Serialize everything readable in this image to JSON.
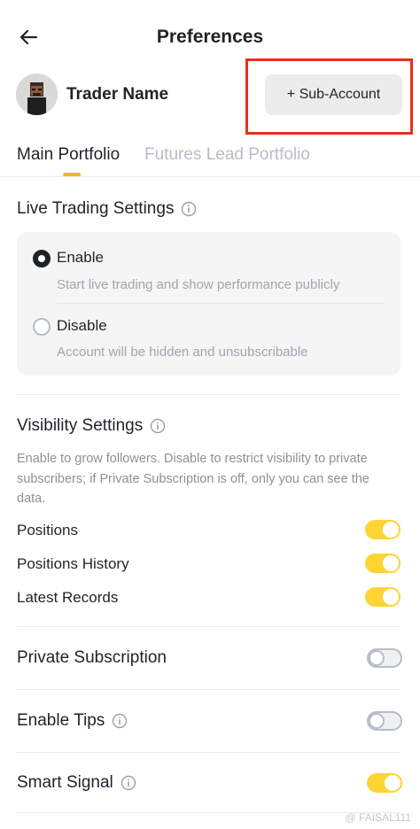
{
  "header": {
    "title": "Preferences"
  },
  "profile": {
    "name": "Trader Name",
    "sub_account_label": "+ Sub-Account"
  },
  "tabs": [
    {
      "label": "Main Portfolio",
      "active": true
    },
    {
      "label": "Futures Lead Portfolio",
      "active": false
    }
  ],
  "live_trading": {
    "title": "Live Trading Settings",
    "options": [
      {
        "label": "Enable",
        "description": "Start live trading and show performance publicly",
        "selected": true
      },
      {
        "label": "Disable",
        "description": "Account will be hidden and unsubscribable",
        "selected": false
      }
    ]
  },
  "visibility": {
    "title": "Visibility Settings",
    "description": "Enable to grow followers. Disable to restrict visibility to private subscribers; if Private Subscription is off, only you can see the data.",
    "items": [
      {
        "label": "Positions",
        "enabled": true
      },
      {
        "label": "Positions History",
        "enabled": true
      },
      {
        "label": "Latest Records",
        "enabled": true
      }
    ]
  },
  "settings": [
    {
      "label": "Private Subscription",
      "enabled": false
    },
    {
      "label": "Enable Tips",
      "enabled": false
    },
    {
      "label": "Smart Signal",
      "enabled": true
    }
  ],
  "watermark": "@ FAISAL111",
  "colors": {
    "accent": "#fcd535",
    "highlight_border": "#e8301c",
    "text_primary": "#1e2329",
    "text_muted": "#a0a6ad"
  }
}
